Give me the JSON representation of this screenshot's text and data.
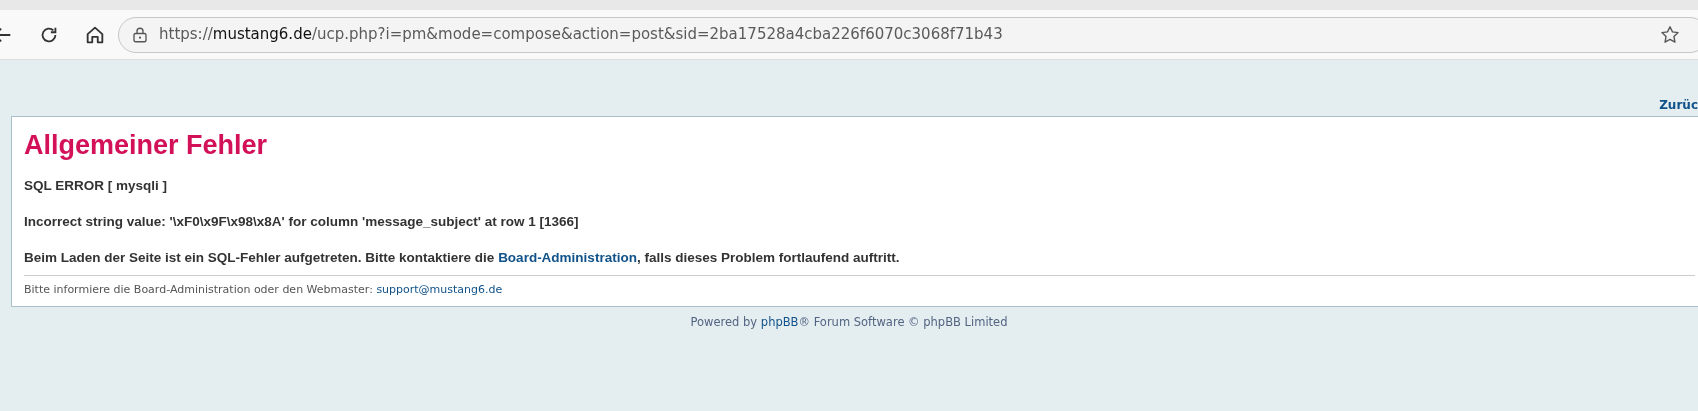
{
  "browser": {
    "url": {
      "scheme": "https://",
      "domain": "mustang6.de",
      "path": "/ucp.php?i=pm&mode=compose&action=post&sid=2ba17528a4cba226f6070c3068f71b43"
    }
  },
  "top_link": "Zurüc",
  "error_panel": {
    "title": "Allgemeiner Fehler",
    "paragraphs": [
      {
        "parts": [
          {
            "text": "SQL ERROR [ mysqli ]",
            "link": false
          }
        ]
      },
      {
        "parts": [
          {
            "text": "Incorrect string value: '\\xF0\\x9F\\x98\\x8A' for column 'message_subject' at row 1 [1366]",
            "link": false
          }
        ]
      },
      {
        "parts": [
          {
            "text": "Beim Laden der Seite ist ein SQL-Fehler aufgetreten. Bitte kontaktiere die ",
            "link": false
          },
          {
            "text": "Board-Administration",
            "link": true
          },
          {
            "text": ", falls dieses Problem fortlaufend auftritt.",
            "link": false
          }
        ]
      }
    ],
    "note": {
      "parts": [
        {
          "text": "Bitte informiere die Board-Administration oder den Webmaster: ",
          "link": false
        },
        {
          "text": "support@mustang6.de",
          "link": true
        }
      ]
    }
  },
  "footer": {
    "parts": [
      {
        "text": "Powered by ",
        "link": false
      },
      {
        "text": "phpBB",
        "link": true
      },
      {
        "text": "® Forum Software © phpBB Limited",
        "link": false
      }
    ]
  }
}
